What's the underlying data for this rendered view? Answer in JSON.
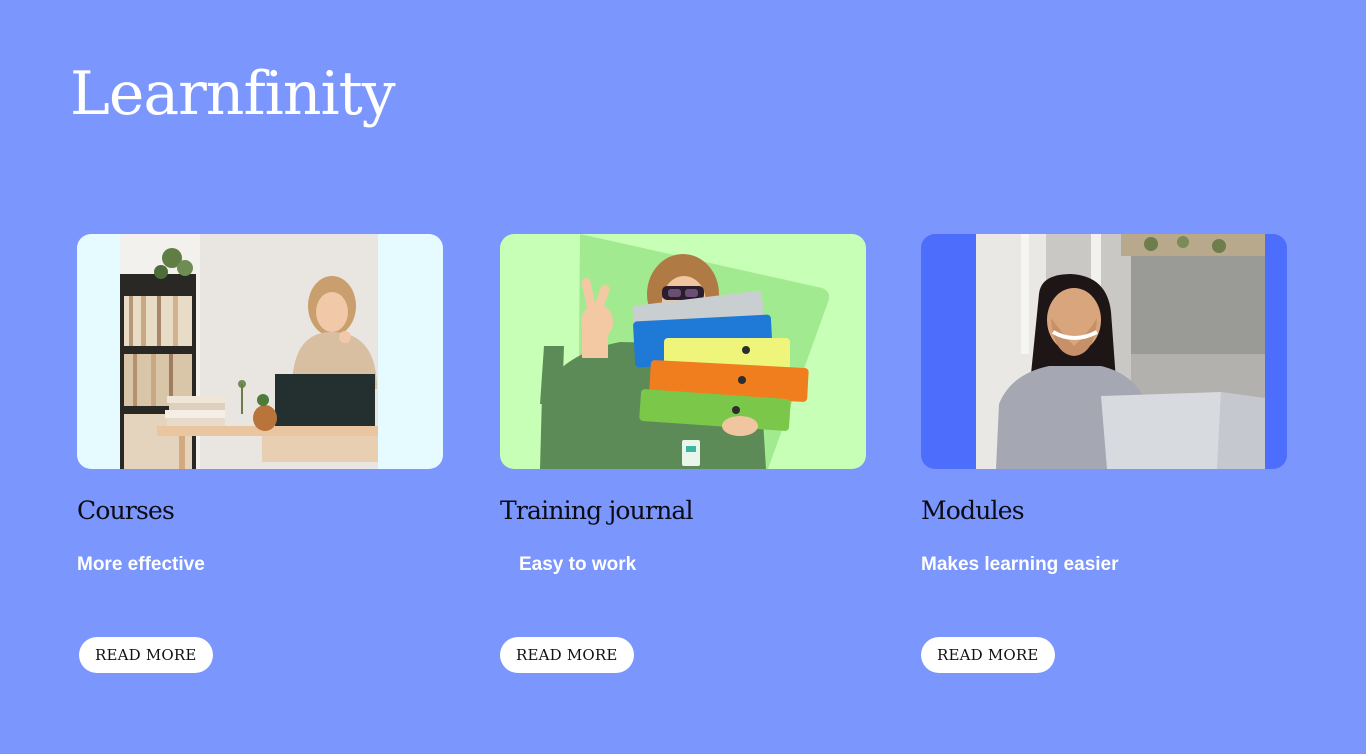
{
  "brand": {
    "name": "Learnfinity"
  },
  "cards": [
    {
      "title": "Courses",
      "subtitle": "More effective",
      "button_label": "READ MORE",
      "image": "woman-at-desk-with-laptop-photo"
    },
    {
      "title": "Training journal",
      "subtitle": "Easy to work",
      "button_label": "READ MORE",
      "image": "person-holding-colorful-folders-photo"
    },
    {
      "title": "Modules",
      "subtitle": "Makes learning easier",
      "button_label": "READ MORE",
      "image": "smiling-woman-with-laptop-photo"
    }
  ],
  "colors": {
    "background": "#7b96fd",
    "button_background": "#ffffff",
    "title_text": "#0b0b14",
    "subtitle_text": "#ffffff"
  }
}
